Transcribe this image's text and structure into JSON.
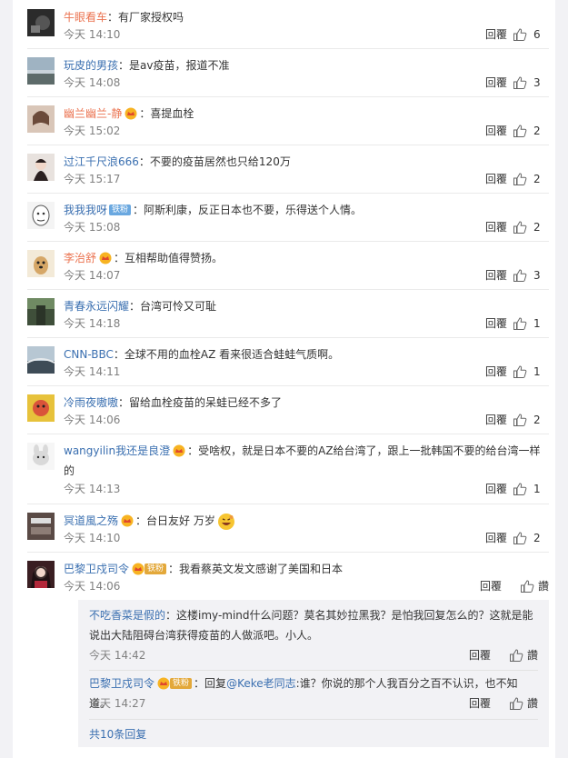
{
  "comments": [
    {
      "user": "牛眼看车",
      "sep": "：",
      "text": "有厂家授权吗",
      "time": "今天 14:10",
      "reply": "回覆",
      "likes": "6"
    },
    {
      "user": "玩皮的男孩",
      "sep": "：",
      "text": "是av疫苗，报道不准",
      "time": "今天 14:08",
      "reply": "回覆",
      "likes": "3"
    },
    {
      "user": "幽兰幽兰-静",
      "sep": "：",
      "text": "喜提血栓",
      "time": "今天 15:02",
      "reply": "回覆",
      "likes": "2"
    },
    {
      "user": "过江千尺浪666",
      "sep": "：",
      "text": "不要的疫苗居然也只给120万",
      "time": "今天 15:17",
      "reply": "回覆",
      "likes": "2"
    },
    {
      "user": "我我我呀",
      "fan": "铁粉",
      "sep": "：",
      "text": "阿斯利康，反正日本也不要，乐得送个人情。",
      "time": "今天 15:08",
      "reply": "回覆",
      "likes": "2"
    },
    {
      "user": "李治舒",
      "sep": "：",
      "text": "互相帮助值得赞扬。",
      "time": "今天 14:07",
      "reply": "回覆",
      "likes": "3"
    },
    {
      "user": "青春永远闪耀",
      "sep": "：",
      "text": "台湾可怜又可耻",
      "time": "今天 14:18",
      "reply": "回覆",
      "likes": "1"
    },
    {
      "user": "CNN-BBC",
      "sep": "：",
      "text": "全球不用的血栓AZ  看来很适合蛙蛙气质啊。",
      "time": "今天 14:11",
      "reply": "回覆",
      "likes": "1"
    },
    {
      "user": "冷雨夜嗷嗷",
      "sep": "：",
      "text": "留给血栓疫苗的呆蛙已经不多了",
      "time": "今天 14:06",
      "reply": "回覆",
      "likes": "2"
    },
    {
      "user": "wangyilin我还是良澄",
      "sep": "：",
      "text": "受啥权，就是日本不要的AZ给台湾了，跟上一批韩国不要的给台湾一样的",
      "time": "今天 14:13",
      "reply": "回覆",
      "likes": "1"
    },
    {
      "user": "冥道風之殇",
      "sep": "：",
      "text": "台日友好 万岁",
      "time": "今天 14:10",
      "reply": "回覆",
      "likes": "2"
    },
    {
      "user": "巴黎卫戍司令",
      "fan": "铁粉",
      "sep": "：",
      "text": "我看蔡英文发文感谢了美国和日本",
      "time": "今天 14:06",
      "reply": "回覆",
      "likes": "讚"
    }
  ],
  "subreplies": [
    {
      "user": "不吃香菜是假的",
      "sep": "：",
      "text": "这楼imy-mind什么问题？莫名其妙拉黑我？是怕我回复怎么的？这就是能说出大陆阻碍台湾获得疫苗的人做派吧。小人。",
      "time": "今天 14:42",
      "reply": "回覆",
      "likes": "讚"
    },
    {
      "user": "巴黎卫戍司令",
      "fan": "铁粉",
      "sep": "：",
      "pre": "回复",
      "mention": "@Keke老同志",
      "text": ":谁？你说的那个人我百分之百不认识，也不知道。",
      "time": "今天 14:27",
      "reply": "回覆",
      "likes": "讚"
    }
  ],
  "more_replies": "共10条回复",
  "colors": {
    "username": "#eb7350",
    "link": "#3a6fb0",
    "meta": "#808080",
    "subbg": "#f2f2f5"
  }
}
